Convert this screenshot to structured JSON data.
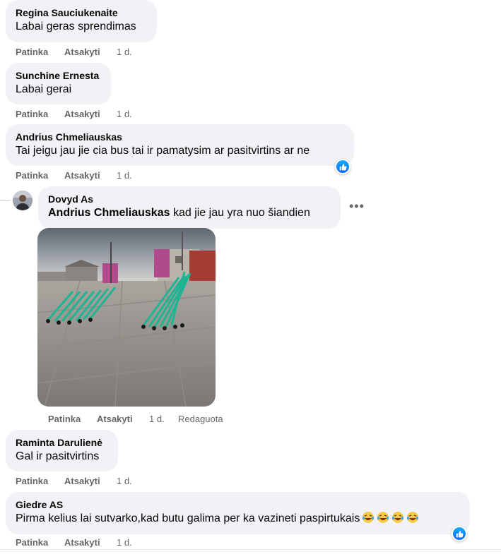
{
  "actions": {
    "like": "Patinka",
    "reply": "Atsakyti",
    "edited": "Redaguota"
  },
  "comments": [
    {
      "author": "Regina Sauciukenaite",
      "text": "Labai geras sprendimas",
      "time": "1 d."
    },
    {
      "author": "Sunchine Ernesta",
      "text": "Labai gerai",
      "time": "1 d."
    },
    {
      "author": "Andrius Chmeliauskas",
      "text": "Tai jeigu jau jie cia bus tai ir pamatysim ar pasitvirtins ar ne",
      "time": "1 d.",
      "reaction_icon": "like-reaction-icon"
    },
    {
      "author": "Dovyd As",
      "mention": "Andrius Chmeliauskas",
      "text": " kad jie jau yra nuo šiandien",
      "time": "1 d.",
      "image": "street-scooters-photo"
    },
    {
      "author": "Raminta Darulienė",
      "text": "Gal ir pasitvirtins",
      "time": "1 d."
    },
    {
      "author": "Giedre AS",
      "text": "Pirma kelius lai sutvarko,kad butu galima per ka vazineti paspirtukais",
      "time": "1 d.",
      "emoji_icon": "laughing-tears-emoji",
      "emoji_count": 4,
      "reaction_icon": "like-reaction-icon"
    }
  ],
  "more_icon": "more-options-icon",
  "colors": {
    "bubble": "#f0f2f5",
    "meta": "#65676b",
    "like_blue": "#0866ff",
    "scooter": "#1fb592"
  }
}
